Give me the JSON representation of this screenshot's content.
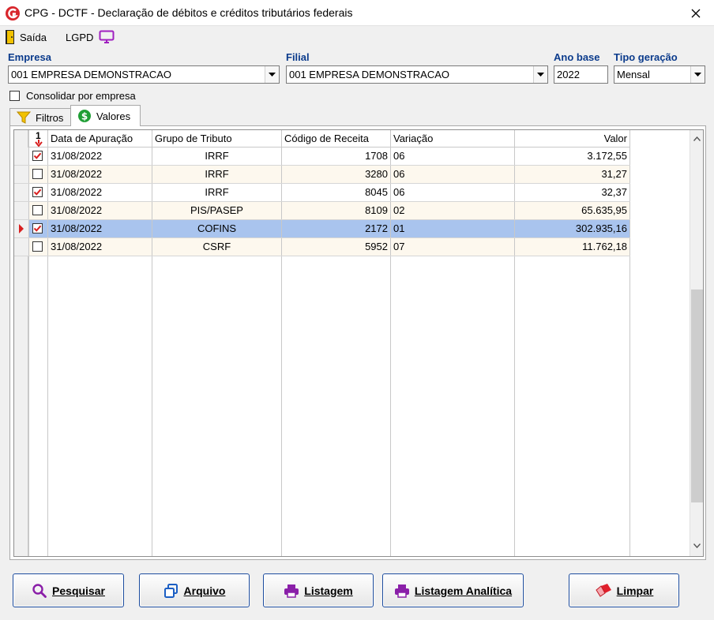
{
  "window": {
    "title": "CPG - DCTF - Declaração de débitos e créditos tributários federais"
  },
  "menu": {
    "saida": "Saída",
    "lgpd": "LGPD"
  },
  "form": {
    "empresa_label": "Empresa",
    "empresa_value": "001 EMPRESA DEMONSTRACAO",
    "filial_label": "Filial",
    "filial_value": "001 EMPRESA DEMONSTRACAO",
    "ano_label": "Ano base",
    "ano_value": "2022",
    "tipo_label": "Tipo geração",
    "tipo_value": "Mensal",
    "consolidar_label": "Consolidar por empresa",
    "consolidar_checked": false
  },
  "tabs": [
    {
      "label": "Filtros",
      "active": false
    },
    {
      "label": "Valores",
      "active": true
    }
  ],
  "grid": {
    "sort_label": "1",
    "columns": [
      "Data de Apuração",
      "Grupo de Tributo",
      "Código de Receita",
      "Variação",
      "Valor"
    ],
    "rows": [
      {
        "checked": true,
        "data": "31/08/2022",
        "grupo": "IRRF",
        "codigo": "1708",
        "variacao": "06",
        "valor": "3.172,55"
      },
      {
        "checked": false,
        "data": "31/08/2022",
        "grupo": "IRRF",
        "codigo": "3280",
        "variacao": "06",
        "valor": "31,27"
      },
      {
        "checked": true,
        "data": "31/08/2022",
        "grupo": "IRRF",
        "codigo": "8045",
        "variacao": "06",
        "valor": "32,37"
      },
      {
        "checked": false,
        "data": "31/08/2022",
        "grupo": "PIS/PASEP",
        "codigo": "8109",
        "variacao": "02",
        "valor": "65.635,95"
      },
      {
        "checked": true,
        "data": "31/08/2022",
        "grupo": "COFINS",
        "codigo": "2172",
        "variacao": "01",
        "valor": "302.935,16"
      },
      {
        "checked": false,
        "data": "31/08/2022",
        "grupo": "CSRF",
        "codigo": "5952",
        "variacao": "07",
        "valor": "11.762,18"
      }
    ],
    "selected_row_index": 4
  },
  "buttons": {
    "pesquisar": "Pesquisar",
    "arquivo": "Arquivo",
    "listagem": "Listagem",
    "listagem_analitica": "Listagem Analítica",
    "limpar": "Limpar"
  },
  "colors": {
    "label_blue": "#0b3b8c",
    "selected_row": "#a9c4ee",
    "alt_row": "#fdf8ee",
    "check_red": "#d81f1f"
  }
}
